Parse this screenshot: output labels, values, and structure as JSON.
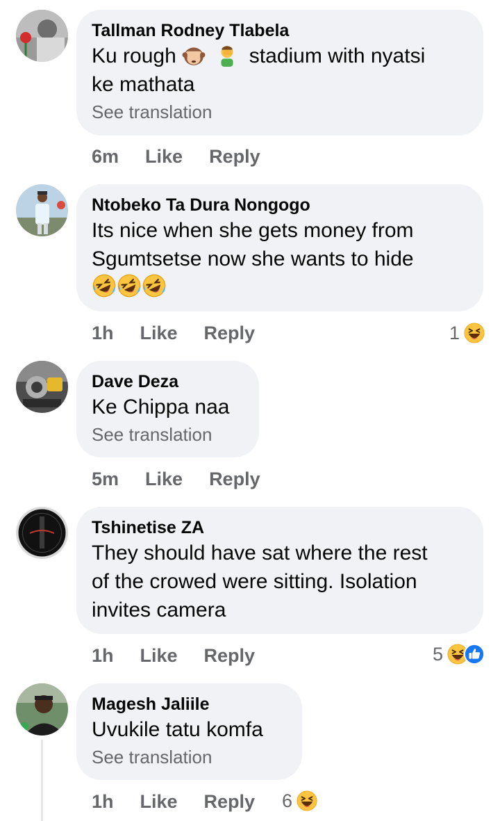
{
  "comments": [
    {
      "author": "Tallman Rodney Tlabela",
      "text_line1": "Ku rough",
      "text_line1b": "stadium with nyatsi",
      "text_line2": "ke mathata",
      "see_translation": "See translation",
      "time": "6m",
      "like": "Like",
      "reply": "Reply",
      "emojis": [
        "see-no-evil-monkey",
        "man-facepalming"
      ]
    },
    {
      "author": "Ntobeko Ta Dura Nongogo",
      "text_line1": "Its nice when she gets money from",
      "text_line2": "Sgumtsetse now she wants to hide",
      "emojis": [
        "rolling-on-floor-laughing",
        "rolling-on-floor-laughing",
        "rolling-on-floor-laughing"
      ],
      "time": "1h",
      "like": "Like",
      "reply": "Reply",
      "reaction_count": "1",
      "reactions": [
        "haha"
      ]
    },
    {
      "author": "Dave Deza",
      "text_line1": "Ke Chippa naa",
      "see_translation": "See translation",
      "time": "5m",
      "like": "Like",
      "reply": "Reply"
    },
    {
      "author": "Tshinetise ZA",
      "text_line1": "They should have sat where the rest",
      "text_line2": "of the crowed were sitting. Isolation",
      "text_line3": "invites camera",
      "time": "1h",
      "like": "Like",
      "reply": "Reply",
      "reaction_count": "5",
      "reactions": [
        "haha",
        "like"
      ]
    },
    {
      "author": "Magesh Jaliile",
      "text_line1": "Uvukile tatu komfa",
      "see_translation": "See translation",
      "time": "1h",
      "like": "Like",
      "reply": "Reply",
      "reaction_count": "6",
      "reactions": [
        "haha"
      ]
    }
  ],
  "colors": {
    "bubble": "#f0f2f5",
    "meta": "#65676b",
    "text": "#050505",
    "like_blue": "#1877f2",
    "haha_yellow": "#fcc43f"
  }
}
